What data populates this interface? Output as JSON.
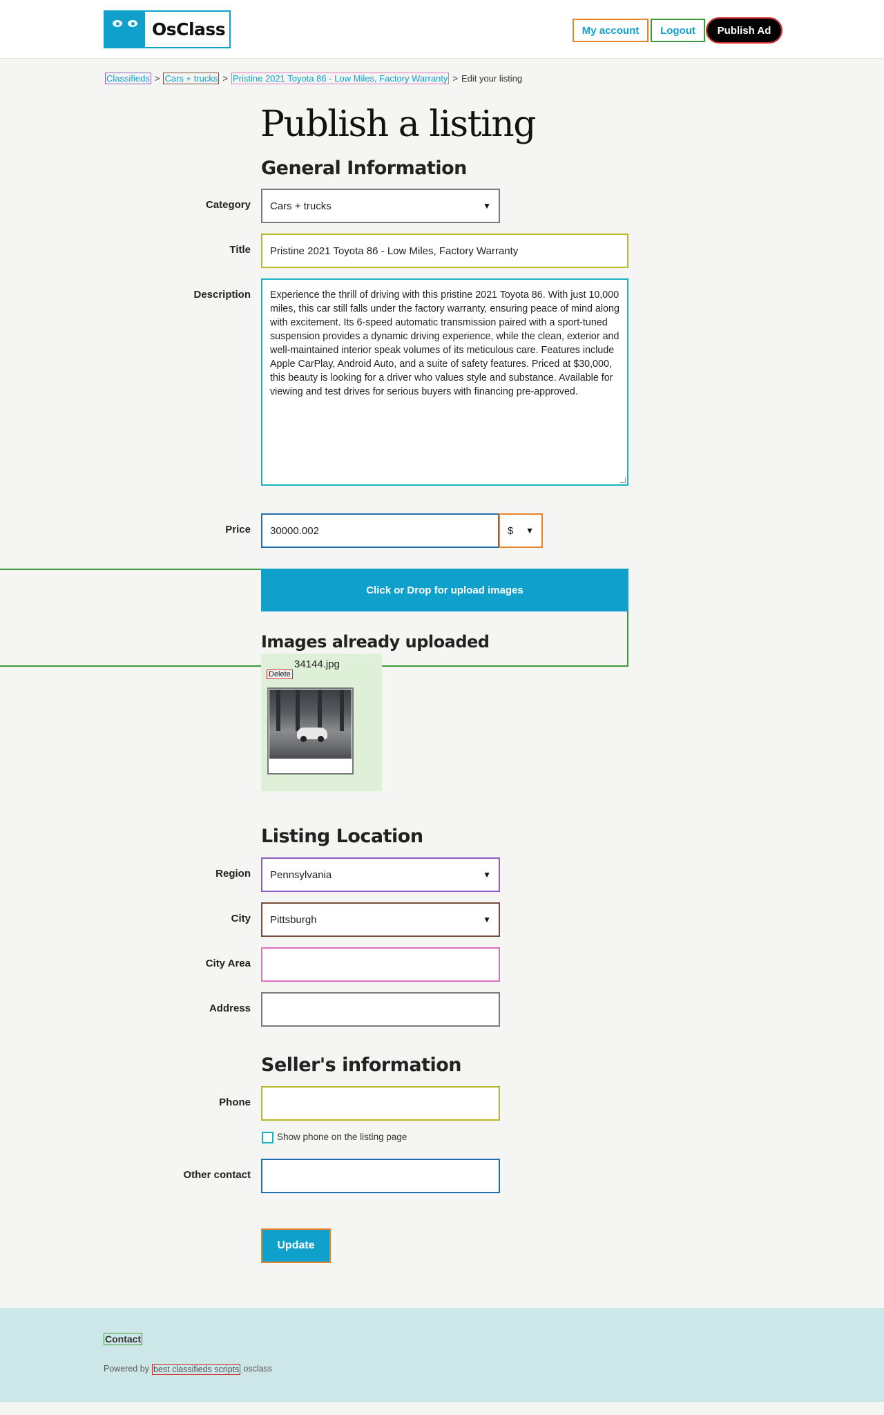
{
  "header": {
    "logo_text": "OsClass",
    "my_account": "My account",
    "logout": "Logout",
    "publish_ad": "Publish Ad"
  },
  "breadcrumb": {
    "classifieds": "Classifieds",
    "separator": ">",
    "cars": "Cars + trucks",
    "listing": "Pristine 2021 Toyota 86 - Low Miles, Factory Warranty",
    "current": "Edit your listing"
  },
  "page_title": "Publish a listing",
  "general": {
    "section_title": "General Information",
    "category_label": "Category",
    "category_value": "Cars + trucks",
    "title_label": "Title",
    "title_value": "Pristine 2021 Toyota 86 - Low Miles, Factory Warranty",
    "description_label": "Description",
    "description_value": "Experience the thrill of driving with this pristine 2021 Toyota 86. With just 10,000 miles, this car still falls under the factory warranty, ensuring peace of mind along with excitement. Its 6-speed automatic transmission paired with a sport-tuned suspension provides a dynamic driving experience, while the clean, exterior and well-maintained interior speak volumes of its meticulous care. Features include Apple CarPlay, Android Auto, and a suite of safety features. Priced at $30,000, this beauty is looking for a driver who values style and substance. Available for viewing and test drives for serious buyers with financing pre-approved.",
    "price_label": "Price",
    "price_value": "30000.002",
    "currency_value": "$"
  },
  "images": {
    "dropzone_label": "Click or Drop for upload images",
    "section_title": "Images already uploaded",
    "file_name": "34144.jpg",
    "delete_label": "Delete"
  },
  "location": {
    "section_title": "Listing Location",
    "region_label": "Region",
    "region_value": "Pennsylvania",
    "city_label": "City",
    "city_value": "Pittsburgh",
    "city_area_label": "City Area",
    "city_area_value": "",
    "address_label": "Address",
    "address_value": ""
  },
  "seller": {
    "section_title": "Seller's information",
    "phone_label": "Phone",
    "phone_value": "",
    "show_phone_label": "Show phone on the listing page",
    "show_phone_checked": false,
    "other_contact_label": "Other contact",
    "other_contact_value": ""
  },
  "update_label": "Update",
  "footer": {
    "contact": "Contact",
    "powered_prefix": "Powered by",
    "powered_link": "best classifieds scripts",
    "powered_suffix": "osclass"
  },
  "colors": {
    "accent": "#0fa0cc",
    "footer_bg": "#cde6e8",
    "uploaded_bg": "#dff0d8"
  }
}
